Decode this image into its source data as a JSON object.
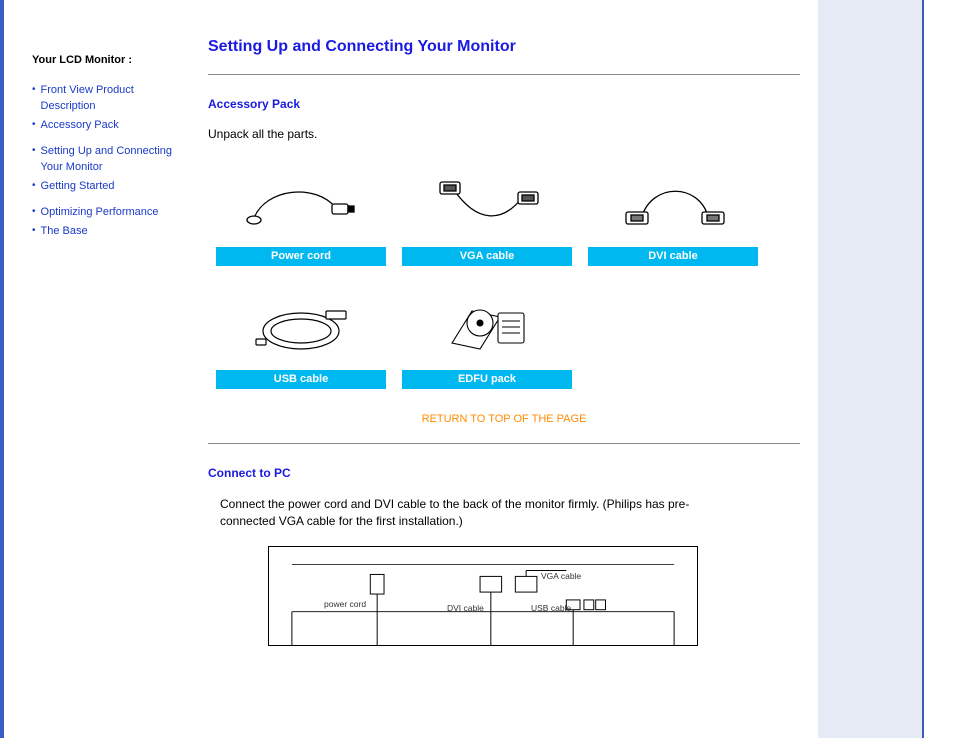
{
  "sidebar": {
    "title": "Your LCD Monitor :",
    "links": [
      {
        "label": "Front View Product Description"
      },
      {
        "label": "Accessory Pack"
      },
      {
        "label": "Setting Up and Connecting Your Monitor"
      },
      {
        "label": "Getting Started"
      },
      {
        "label": "Optimizing Performance"
      },
      {
        "label": "The Base"
      }
    ]
  },
  "main": {
    "title": "Setting Up and Connecting Your Monitor",
    "accessory": {
      "heading": "Accessory Pack",
      "intro": "Unpack all the parts.",
      "items": [
        {
          "label": "Power cord"
        },
        {
          "label": "VGA cable"
        },
        {
          "label": "DVI cable"
        },
        {
          "label": "USB cable"
        },
        {
          "label": "EDFU pack"
        }
      ]
    },
    "return_link": "RETURN TO TOP OF THE PAGE",
    "connect": {
      "heading": "Connect to PC",
      "text": "Connect the power cord and DVI cable to the back of the monitor firmly. (Philips has pre-connected VGA cable for the first installation.)",
      "diagram_labels": {
        "power": "power cord",
        "dvi": "DVI cable",
        "vga": "VGA cable",
        "usb": "USB cable"
      }
    }
  }
}
